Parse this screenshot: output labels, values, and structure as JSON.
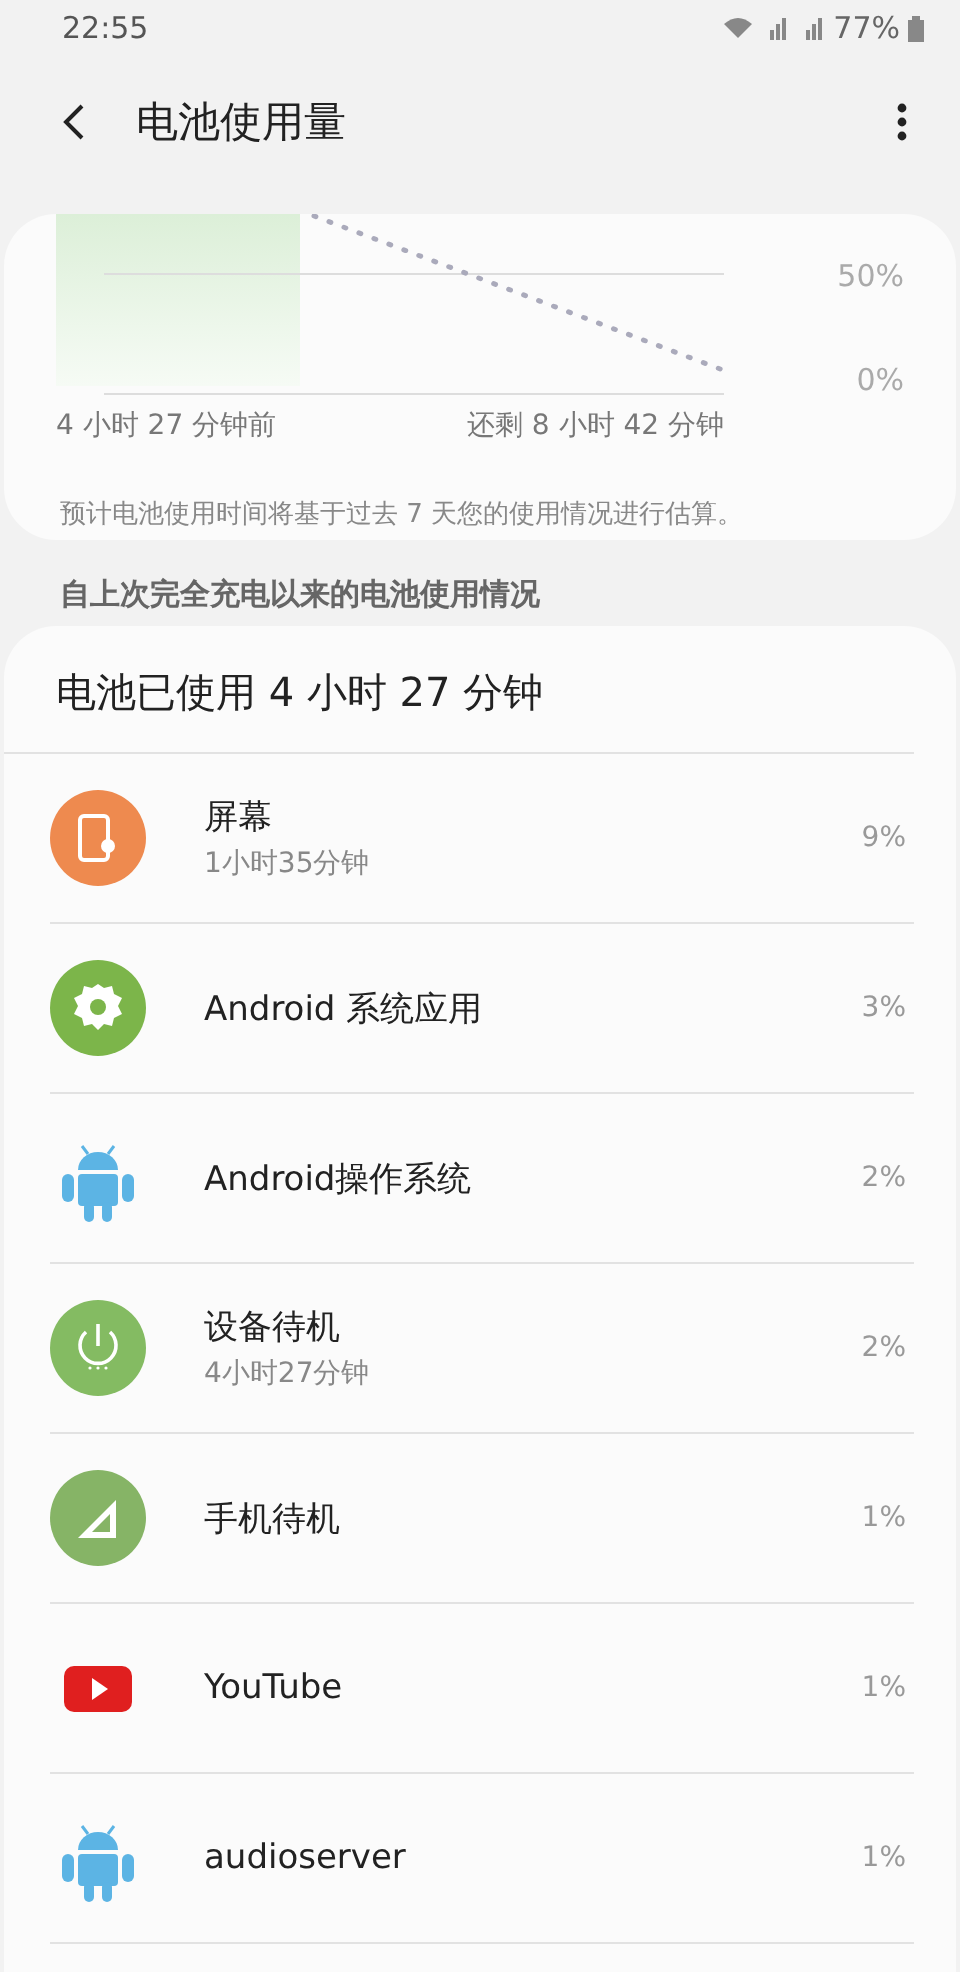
{
  "status_bar": {
    "time": "22:55",
    "battery_text": "77%"
  },
  "header": {
    "title": "电池使用量"
  },
  "chart": {
    "y_labels": [
      "50%",
      "0%"
    ],
    "start_label": "4 小时 27 分钟前",
    "end_label": "还剩 8 小时 42 分钟",
    "note": "预计电池使用时间将基于过去 7 天您的使用情况进行估算。"
  },
  "section_title": "自上次完全充电以来的电池使用情况",
  "usage": {
    "title": "电池已使用 4 小时 27 分钟",
    "items": [
      {
        "kind": "screen",
        "name": "屏幕",
        "detail": "1小时35分钟",
        "percent": "9%"
      },
      {
        "kind": "gear",
        "name": "Android 系统应用",
        "percent": "3%"
      },
      {
        "kind": "android",
        "name": "Android操作系统",
        "percent": "2%"
      },
      {
        "kind": "power",
        "name": "设备待机",
        "detail": "4小时27分钟",
        "percent": "2%"
      },
      {
        "kind": "signal",
        "name": "手机待机",
        "percent": "1%"
      },
      {
        "kind": "youtube",
        "name": "YouTube",
        "percent": "1%"
      },
      {
        "kind": "android",
        "name": "audioserver",
        "percent": "1%"
      }
    ]
  }
}
